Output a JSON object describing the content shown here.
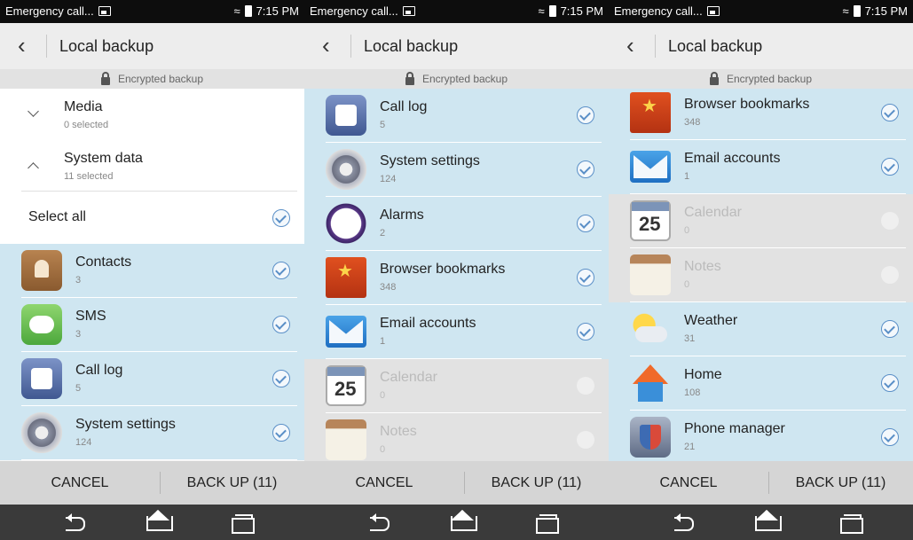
{
  "status": {
    "carrier": "Emergency call...",
    "time": "7:15 PM"
  },
  "header": {
    "title": "Local backup",
    "subtitle": "Encrypted backup"
  },
  "footer": {
    "cancel": "CANCEL",
    "backup": "BACK UP (11)"
  },
  "panel1": {
    "media": {
      "title": "Media",
      "sub": "0 selected"
    },
    "system": {
      "title": "System data",
      "sub": "11 selected"
    },
    "select_all": "Select all",
    "items": [
      {
        "title": "Contacts",
        "sub": "3"
      },
      {
        "title": "SMS",
        "sub": "3"
      },
      {
        "title": "Call log",
        "sub": "5"
      },
      {
        "title": "System settings",
        "sub": "124"
      }
    ]
  },
  "panel2": {
    "items": [
      {
        "title": "Call log",
        "sub": "5"
      },
      {
        "title": "System settings",
        "sub": "124"
      },
      {
        "title": "Alarms",
        "sub": "2"
      },
      {
        "title": "Browser bookmarks",
        "sub": "348"
      },
      {
        "title": "Email accounts",
        "sub": "1"
      },
      {
        "title": "Calendar",
        "sub": "0"
      },
      {
        "title": "Notes",
        "sub": "0"
      }
    ]
  },
  "panel3": {
    "items": [
      {
        "title": "Browser bookmarks",
        "sub": "348"
      },
      {
        "title": "Email accounts",
        "sub": "1"
      },
      {
        "title": "Calendar",
        "sub": "0"
      },
      {
        "title": "Notes",
        "sub": "0"
      },
      {
        "title": "Weather",
        "sub": "31"
      },
      {
        "title": "Home",
        "sub": "108"
      },
      {
        "title": "Phone manager",
        "sub": "21"
      }
    ]
  },
  "colors": {
    "selected_row": "#cfe6f1",
    "disabled_row": "#e2e2e2",
    "check": "#5a8fc7",
    "footer": "#d5d5d5",
    "navbar": "#3a3a3a"
  }
}
